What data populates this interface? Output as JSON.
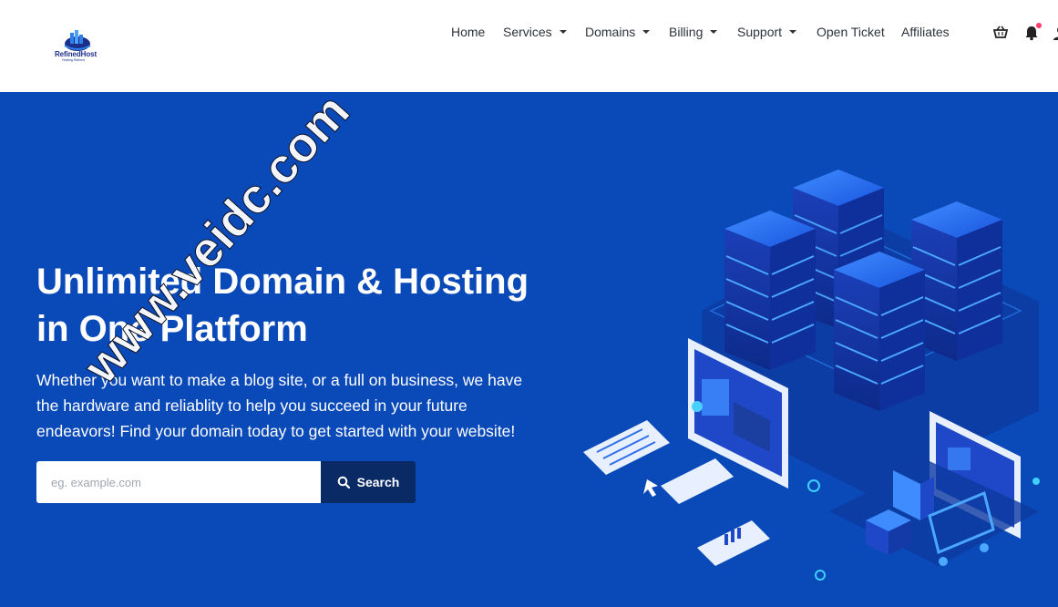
{
  "brand": {
    "name": "RefinedHost",
    "tagline": "Hosting Refined"
  },
  "nav": {
    "home": "Home",
    "services": "Services",
    "domains": "Domains",
    "billing": "Billing",
    "support": "Support",
    "open_ticket": "Open Ticket",
    "affiliates": "Affiliates"
  },
  "icons": [
    "cart-icon",
    "bell-icon",
    "user-icon"
  ],
  "hero": {
    "title_line1": "Unlimited Domain & Hosting",
    "title_line2": "in One Platform",
    "description": "Whether you want to make a blog site, or a full on business, we have the hardware and reliablity to help you succeed in your future endeavors! Find your domain today to get started with your website!",
    "search_placeholder": "eg. example.com",
    "search_button": "Search",
    "watermark": "www.veidc.com"
  },
  "colors": {
    "hero_bg": "#0a4ab8",
    "button_bg": "#0a2a66",
    "notification_dot": "#ff3b6b"
  }
}
